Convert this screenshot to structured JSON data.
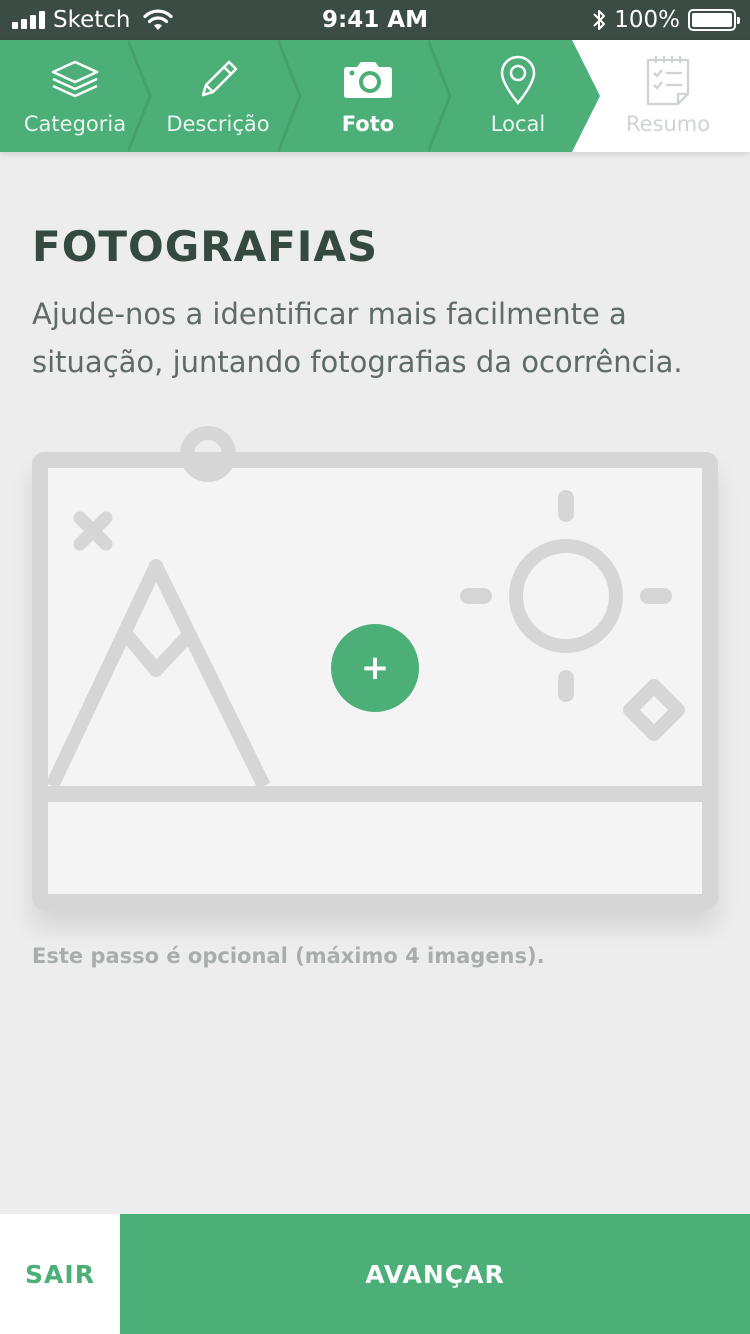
{
  "status_bar": {
    "carrier": "Sketch",
    "time": "9:41 AM",
    "battery_label": "100%",
    "battery_level": 1.0
  },
  "steps": [
    {
      "label": "Categoria",
      "icon": "layers-icon",
      "state": "done"
    },
    {
      "label": "Descrição",
      "icon": "pencil-icon",
      "state": "done"
    },
    {
      "label": "Foto",
      "icon": "camera-icon",
      "state": "active"
    },
    {
      "label": "Local",
      "icon": "location-pin-icon",
      "state": "done"
    },
    {
      "label": "Resumo",
      "icon": "checklist-icon",
      "state": "future"
    }
  ],
  "main": {
    "title": "FOTOGRAFIAS",
    "description": "Ajude-nos a identificar mais facilmente a situação, juntando fotografias da ocorrência.",
    "add_button_symbol": "+",
    "note": "Este passo é opcional (máximo 4 imagens)."
  },
  "actions": {
    "exit_label": "SAIR",
    "next_label": "AVANÇAR"
  },
  "colors": {
    "accent": "#4caf78",
    "status_bar": "#3a4c43",
    "title": "#344a40",
    "background": "#ededed",
    "placeholder_lines": "#d6d6d6"
  }
}
